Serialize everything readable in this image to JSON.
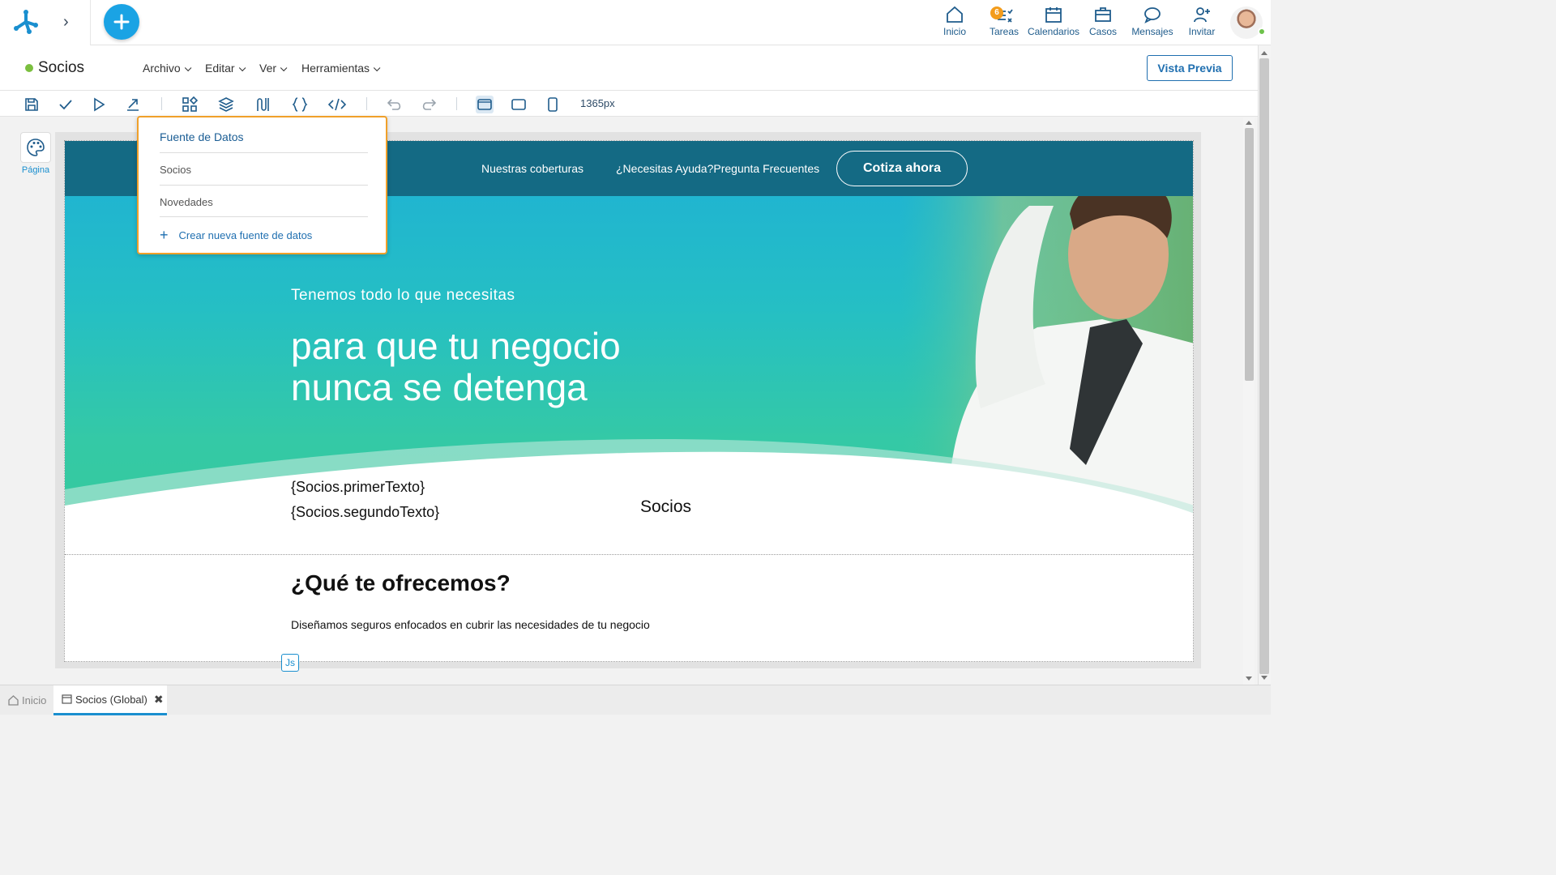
{
  "topbar": {
    "nav": [
      {
        "label": "Inicio",
        "icon": "home-icon"
      },
      {
        "label": "Tareas",
        "icon": "tasks-icon",
        "badge": "6"
      },
      {
        "label": "Calendarios",
        "icon": "calendar-icon"
      },
      {
        "label": "Casos",
        "icon": "briefcase-icon"
      },
      {
        "label": "Mensajes",
        "icon": "message-icon"
      },
      {
        "label": "Invitar",
        "icon": "invite-user-icon"
      }
    ]
  },
  "menubar": {
    "title": "Socios",
    "menus": [
      "Archivo",
      "Editar",
      "Ver",
      "Herramientas"
    ],
    "preview_label": "Vista Previa"
  },
  "toolbar": {
    "width_label": "1365px"
  },
  "left_panel": {
    "label": "Página"
  },
  "dropdown": {
    "header": "Fuente de Datos",
    "items": [
      "Socios",
      "Novedades"
    ],
    "create_label": "Crear nueva fuente de datos"
  },
  "page": {
    "nav_links": [
      "Nuestras coberturas",
      "¿Necesitas Ayuda?Pregunta Frecuentes"
    ],
    "cta_label": "Cotiza ahora",
    "hero_subtitle": "Tenemos todo lo que necesitas",
    "hero_title_line1": "para que tu negocio",
    "hero_title_line2": "nunca se detenga",
    "field1": "{Socios.primerTexto}",
    "field2": "{Socios.segundoTexto}",
    "socios_label": "Socios",
    "offer_title": "¿Qué te ofrecemos?",
    "offer_text": "Diseñamos seguros enfocados en cubrir las necesidades de tu negocio",
    "js_chip": "Js"
  },
  "bottom_tabs": [
    {
      "label": "Inicio",
      "icon": "home-icon"
    },
    {
      "label": "Socios (Global)",
      "icon": "page-icon"
    }
  ],
  "colors": {
    "accent": "#1aa3e4",
    "nav_dark": "#146a84",
    "dropdown_border": "#f0a02a",
    "status_dot": "#7bbf3f"
  }
}
